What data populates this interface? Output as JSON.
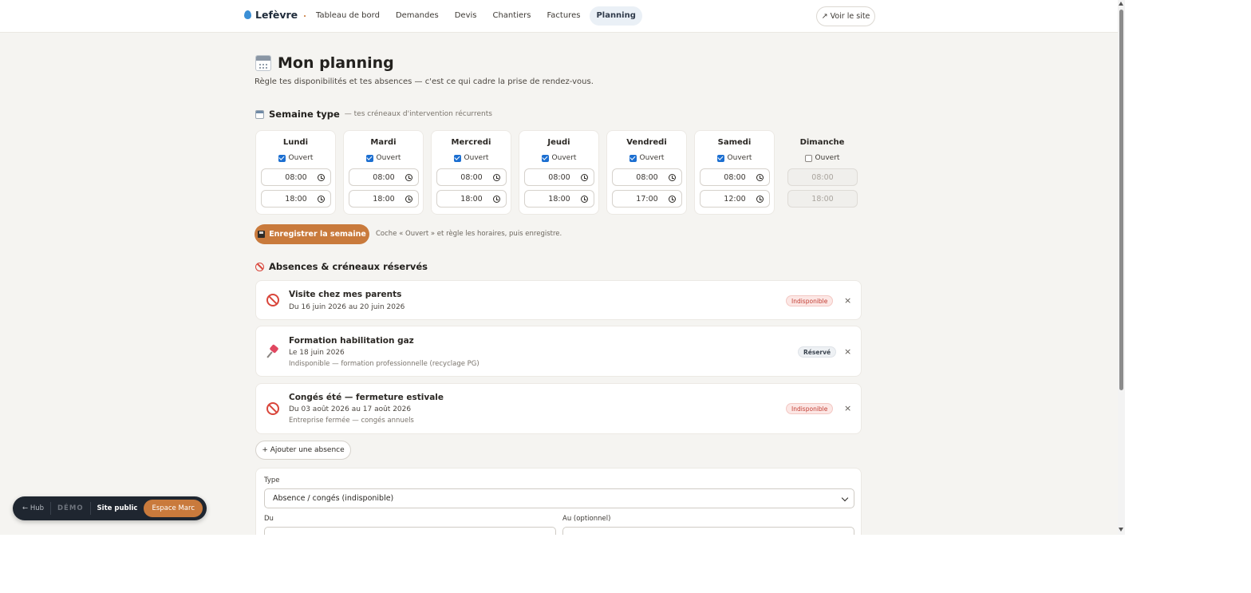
{
  "header": {
    "logo_text": "Lefèvre",
    "logo_dot": ".",
    "nav": [
      {
        "label": "Tableau de bord",
        "active": false
      },
      {
        "label": "Demandes",
        "active": false
      },
      {
        "label": "Devis",
        "active": false
      },
      {
        "label": "Chantiers",
        "active": false
      },
      {
        "label": "Factures",
        "active": false
      },
      {
        "label": "Planning",
        "active": true
      }
    ],
    "voir_site": "↗ Voir le site"
  },
  "page": {
    "title": "Mon planning",
    "subtitle": "Règle tes disponibilités et tes absences — c'est ce qui cadre la prise de rendez-vous."
  },
  "semaine": {
    "heading": "Semaine type",
    "hint": "— tes créneaux d'intervention récurrents",
    "open_label": "Ouvert",
    "days": [
      {
        "name": "Lundi",
        "open": true,
        "start": "08:00",
        "end": "18:00"
      },
      {
        "name": "Mardi",
        "open": true,
        "start": "08:00",
        "end": "18:00"
      },
      {
        "name": "Mercredi",
        "open": true,
        "start": "08:00",
        "end": "18:00"
      },
      {
        "name": "Jeudi",
        "open": true,
        "start": "08:00",
        "end": "18:00"
      },
      {
        "name": "Vendredi",
        "open": true,
        "start": "08:00",
        "end": "17:00"
      },
      {
        "name": "Samedi",
        "open": true,
        "start": "08:00",
        "end": "12:00"
      },
      {
        "name": "Dimanche",
        "open": false,
        "start": "08:00",
        "end": "18:00"
      }
    ],
    "save_label": "Enregistrer la semaine",
    "save_hint": "Coche « Ouvert » et règle les horaires, puis enregistre."
  },
  "absences": {
    "heading": "Absences & créneaux réservés",
    "items": [
      {
        "icon": "no-entry-icon",
        "title": "Visite chez mes parents",
        "date": "Du 16 juin 2026 au 20 juin 2026",
        "note": "",
        "badge": "Indisponible",
        "badge_color": "red"
      },
      {
        "icon": "pushpin-icon",
        "title": "Formation habilitation gaz",
        "date": "Le 18 juin 2026",
        "note": "Indisponible — formation professionnelle (recyclage PG)",
        "badge": "Réservé",
        "badge_color": "gray"
      },
      {
        "icon": "no-entry-icon",
        "title": "Congés été — fermeture estivale",
        "date": "Du 03 août 2026 au 17 août 2026",
        "note": "Entreprise fermée — congés annuels",
        "badge": "Indisponible",
        "badge_color": "red"
      }
    ],
    "add_label": "+ Ajouter une absence",
    "close_glyph": "×"
  },
  "form": {
    "type_label": "Type",
    "type_value": "Absence / congés (indisponible)",
    "du_label": "Du",
    "au_label": "Au (optionnel)"
  },
  "demo_bar": {
    "hub": "← Hub",
    "demo": "DÉMO",
    "site": "Site public",
    "espace": "Espace Marc"
  },
  "colors": {
    "accent": "#c97a3c",
    "background": "#f5f4f1",
    "checkbox": "#1c6fd1",
    "danger": "#d9463b"
  }
}
